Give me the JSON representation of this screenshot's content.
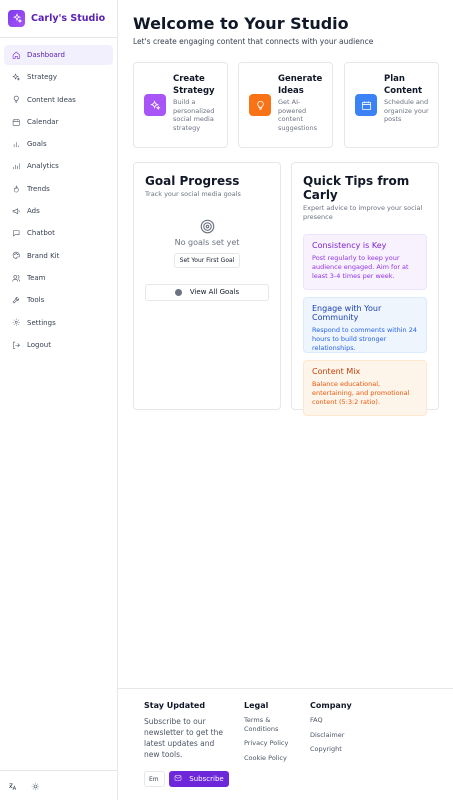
{
  "brand": {
    "name": "Carly's Studio"
  },
  "sidebar": {
    "items": [
      {
        "label": "Dashboard",
        "icon": "home-icon",
        "active": true
      },
      {
        "label": "Strategy",
        "icon": "sparkles-icon"
      },
      {
        "label": "Content Ideas",
        "icon": "lightbulb-icon"
      },
      {
        "label": "Calendar",
        "icon": "calendar-icon"
      },
      {
        "label": "Goals",
        "icon": "bar-chart-icon"
      },
      {
        "label": "Analytics",
        "icon": "analytics-icon"
      },
      {
        "label": "Trends",
        "icon": "flame-icon"
      },
      {
        "label": "Ads",
        "icon": "megaphone-icon"
      },
      {
        "label": "Chatbot",
        "icon": "chat-icon"
      },
      {
        "label": "Brand Kit",
        "icon": "palette-icon"
      },
      {
        "label": "Team",
        "icon": "users-icon"
      },
      {
        "label": "Tools",
        "icon": "wrench-icon"
      },
      {
        "label": "Settings",
        "icon": "gear-icon"
      },
      {
        "label": "Logout",
        "icon": "logout-icon"
      }
    ],
    "footer_icons": [
      "translate-icon",
      "theme-icon"
    ]
  },
  "header": {
    "title": "Welcome to Your Studio",
    "subtitle": "Let's create engaging content that connects with your audience"
  },
  "actions": [
    {
      "title": "Create Strategy",
      "desc": "Build a personalized social media strategy",
      "color": "#a855f7",
      "icon": "sparkles-icon"
    },
    {
      "title": "Generate Ideas",
      "desc": "Get AI-powered content suggestions",
      "color": "#f97316",
      "icon": "lightbulb-icon"
    },
    {
      "title": "Plan Content",
      "desc": "Schedule and organize your posts",
      "color": "#3b82f6",
      "icon": "calendar-icon"
    }
  ],
  "goals": {
    "title": "Goal Progress",
    "subtitle": "Track your social media goals",
    "empty_text": "No goals set yet",
    "set_goal_label": "Set Your First Goal",
    "view_all_label": "View All Goals"
  },
  "tips": {
    "title": "Quick Tips from Carly",
    "subtitle": "Expert advice to improve your social presence",
    "items": [
      {
        "title": "Consistency is Key",
        "text": "Post regularly to keep your audience engaged. Aim for at least 3-4 times per week."
      },
      {
        "title": "Engage with Your Community",
        "text": "Respond to comments within 24 hours to build stronger relationships."
      },
      {
        "title": "Content Mix",
        "text": "Balance educational, entertaining, and promotional content (5:3:2 ratio)."
      }
    ]
  },
  "footer": {
    "stay_updated": {
      "title": "Stay Updated",
      "text": "Subscribe to our newsletter to get the latest updates and new tools.",
      "email_value": "Em",
      "subscribe_label": "Subscribe"
    },
    "legal": {
      "title": "Legal",
      "links": [
        "Terms & Conditions",
        "Privacy Policy",
        "Cookie Policy"
      ]
    },
    "company": {
      "title": "Company",
      "links": [
        "FAQ",
        "Disclaimer",
        "Copyright"
      ]
    }
  },
  "colors": {
    "brand": "#6d28d9",
    "active_bg": "#f3f0fd"
  }
}
